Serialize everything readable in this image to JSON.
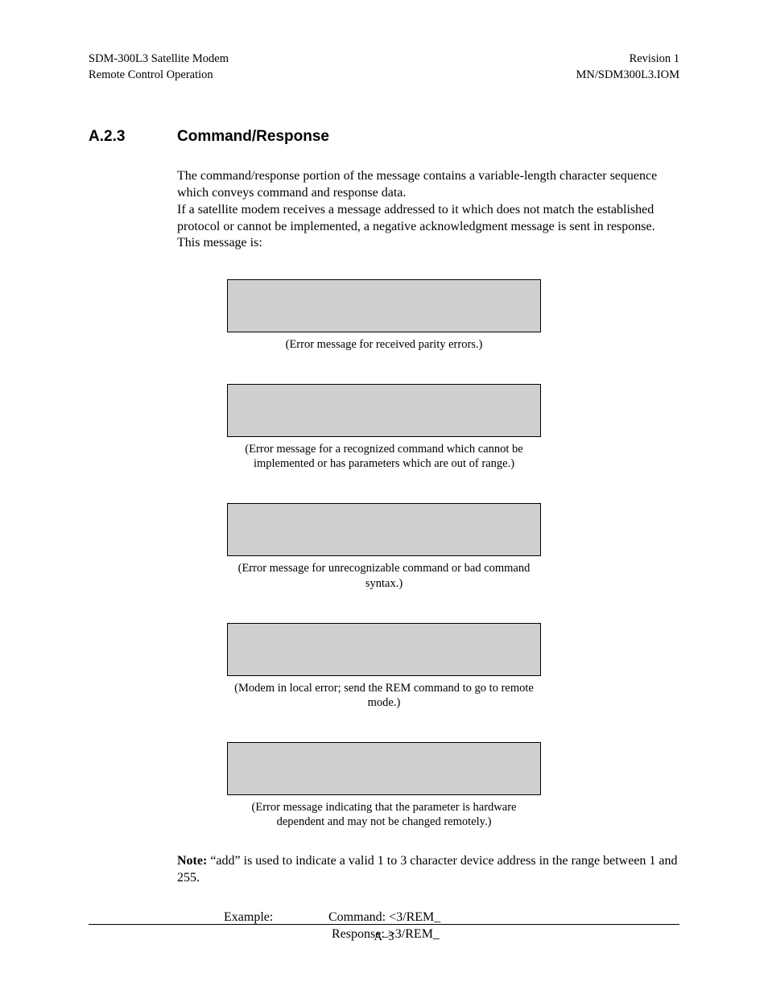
{
  "header": {
    "left_line1": "SDM-300L3 Satellite Modem",
    "left_line2": "Remote Control Operation",
    "right_line1": "Revision 1",
    "right_line2": "MN/SDM300L3.IOM"
  },
  "section": {
    "number": "A.2.3",
    "title": "Command/Response"
  },
  "body": {
    "p1": "The command/response portion of the message contains a variable-length character sequence which conveys command and response data.",
    "p2": "If a satellite modem receives a message addressed to it which does not match the established protocol or cannot be implemented, a negative acknowledgment message is sent in response. This message is:"
  },
  "boxes": [
    {
      "caption": "(Error message for received parity errors.)"
    },
    {
      "caption": "(Error message for a recognized command which cannot be implemented or has parameters which are out of range.)"
    },
    {
      "caption": "(Error message for unrecognizable command or bad command syntax.)"
    },
    {
      "caption": "(Modem in local error; send the REM command to go to remote mode.)"
    },
    {
      "caption": "(Error message indicating that the parameter is hardware dependent and may not be changed remotely.)"
    }
  ],
  "note": {
    "label": "Note:",
    "text": " “add” is used to indicate a valid 1 to 3 character device address in the range between 1 and 255."
  },
  "example": {
    "label": "Example:",
    "command": "Command: <3/REM_",
    "response": "Response: >3/REM_"
  },
  "footer": {
    "page": "A–3"
  }
}
